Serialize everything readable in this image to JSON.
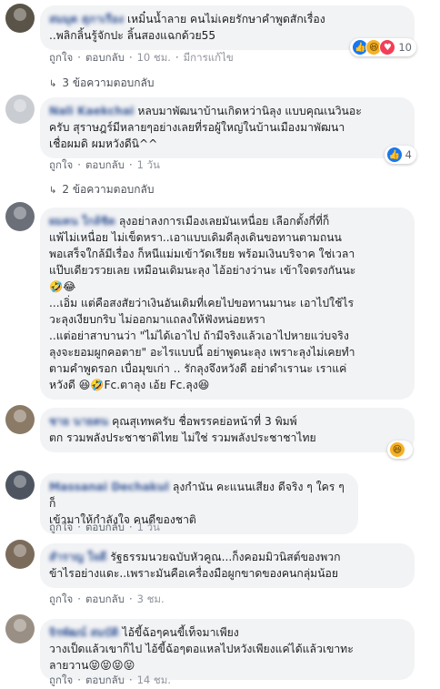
{
  "comments": [
    {
      "name": "สมมุต สุภาเรือง",
      "text": "เหมิ๋นน้ำลาย คนไม่เคยรักษาคำพูดสักเรื่อง\n..พลิกลิ้นรู้จักปะ ลิ้นสองแฉกด้วย55",
      "like": "ถูกใจ",
      "reply": "ตอบกลับ",
      "time": "10 ชม.",
      "edited": "มีการแก้ไข",
      "reactions": "10",
      "replies_label": "3 ข้อความตอบกลับ"
    },
    {
      "name": "Nali Kaekchai",
      "text": "หลบมาพัฒนาบ้านเกิดหว่านิลุง แบบคุณเนวินอะ\nครับ สุราษฎร์มีหลายๆอย่างเลยที่รอผู้ใหญ่ในบ้านเมืองมาพัฒนา\nเชื่อผมดิ ผมหวังดีนิ^^",
      "like": "ถูกใจ",
      "reply": "ตอบกลับ",
      "time": "1 วัน",
      "reactions": "4",
      "replies_label": "2 ข้อความตอบกลับ"
    },
    {
      "name": "ผมคน ใกล้ชิด",
      "text": "ลุงอย่าลงการเมืองเลยมันเหนื่อย เลือกตั้งกี่ที่ก็\nแพ้ไม่เหนื่อย ไม่เข็ดหรา..เอาแบบเดิมดีลุงเดินขอทานตามถนน\nพอเสร็จใกล้มีเรื่อง ก็หนีแม่มเข้าวัดเรียย พร้อมเงินบริจาค ใช่เวลา\nแป๊บเดียวรวยเลย เหมือนเดิมนะลุง ไอ้อย่างว่านะ เข้าใจตรงกันนะ\n🤣😂\n...เอิ่ม แต่คือสงสัยว่าเงินอันเดิมที่เคยไปขอทานมานะ เอาไปใช้ไร\nวะลุงเงียบกริบ ไม่ออกมาแถลงให้ฟังหน่อยหรา\n..แต่อย่าสาบานว่า \"ไม่ได้เอาไป ถ้ามีจริงแล้วเอาไปหายแว่บจริง\nลุงจะยอมผูกคอตาย\" อะไรแบบนี้ อย่าพูดนะลุง เพราะลุงไม่เคยทำ\nตามคำพูดรอก เบื่อมุขเก่า .. รักลุงจึงหวังดี อย่าดำเรานะ เราแค่\nหวังดี 😆🤣Fc.ตาลุง เอ้ย Fc.ลุง😆",
      "like": "",
      "reply": "",
      "time": "",
      "reactions": "",
      "replies_label": ""
    },
    {
      "name": "ชาย นายตน",
      "text": "คุณสุเทพครับ ชื่อพรรคย่อหน้าที่ 3 พิมพ์\nตก รวมพลังประชาชาติไทย ไม่ใช่ รวมพลังประชาชาไทย",
      "like": "",
      "reply": "",
      "time": "",
      "reactions": "",
      "replies_label": ""
    },
    {
      "name": "Massanai Dechakul",
      "text": "ลุงกำนัน คะแนนเสียง ดีจริง ๆ ใคร ๆ ก็\nเข้ามาให้กำลังใจ คนดีของชาติ",
      "like": "ถูกใจ",
      "reply": "ตอบกลับ",
      "time": "1 วัน",
      "reactions": "",
      "replies_label": ""
    },
    {
      "name": "สำราญ ใจดี",
      "text": "รัฐธรรมนวยฉบับหัวคูณ...ก็งคอมมิวนิสต์ของพวก\nข้าไรอย่างแดะ..เพราะมันคือเครื่องมือผูกขาดของคนกลุ่มน้อย",
      "like": "ถูกใจ",
      "reply": "ตอบกลับ",
      "time": "3 ชม.",
      "reactions": "",
      "replies_label": ""
    },
    {
      "name": "จิรพัฒน์ สมบัติ",
      "text": "ไอ้ขี้ฉ้อๆคนขี้เท็จมาเพียง\nวางเป็ดแล้วเขาก็ไป ไอ้ขี้ฉ้อๆตอแหลไปหวังเพียงแค่ได้แล้วเขาทะ\nลายวาน😝😝😝😝",
      "like": "ถูกใจ",
      "reply": "ตอบกลับ",
      "time": "14 ชม.",
      "reactions": "",
      "replies_label": ""
    }
  ],
  "icons": {
    "like": "thumbs-up",
    "haha": "laughing-face",
    "love": "heart",
    "reply_arrow": "reply-arrow"
  },
  "colors": {
    "link": "#385898",
    "bubble": "#f2f3f5",
    "meta": "#616770",
    "like_blue": "#1877f2"
  }
}
